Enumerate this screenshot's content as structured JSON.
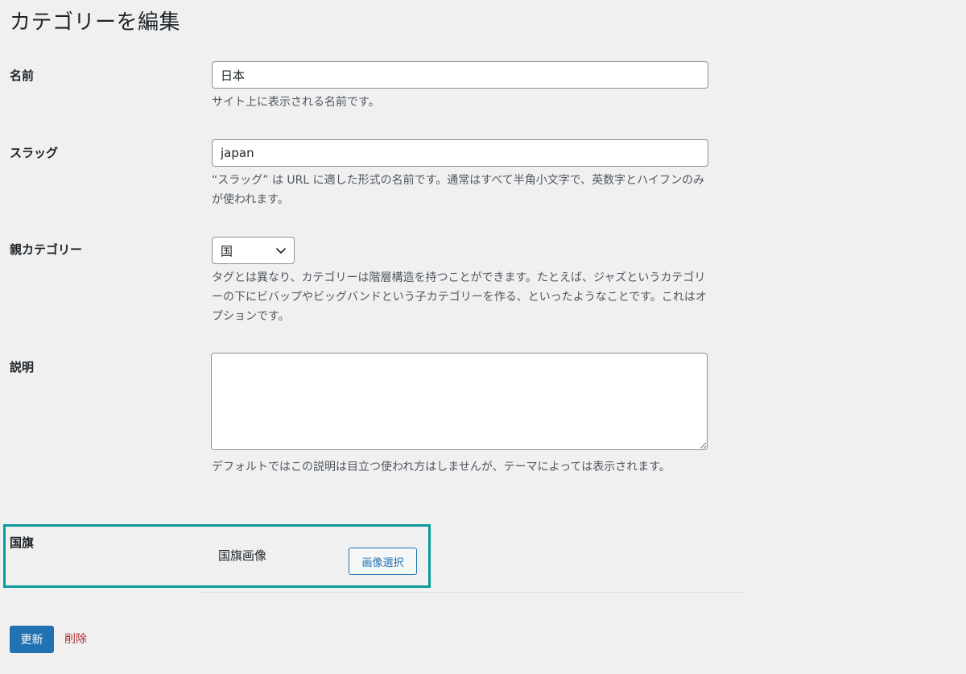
{
  "page": {
    "title": "カテゴリーを編集"
  },
  "fields": {
    "name": {
      "label": "名前",
      "value": "日本",
      "help": "サイト上に表示される名前です。"
    },
    "slug": {
      "label": "スラッグ",
      "value": "japan",
      "help": "“スラッグ” は URL に適した形式の名前です。通常はすべて半角小文字で、英数字とハイフンのみが使われます。"
    },
    "parent": {
      "label": "親カテゴリー",
      "selected": "国",
      "help": "タグとは異なり、カテゴリーは階層構造を持つことができます。たとえば、ジャズというカテゴリーの下にビバップやビッグバンドという子カテゴリーを作る、といったようなことです。これはオプションです。"
    },
    "description": {
      "label": "説明",
      "value": "",
      "help": "デフォルトではこの説明は目立つ使われ方はしませんが、テーマによっては表示されます。"
    },
    "flag": {
      "label": "国旗",
      "field_label": "国旗画像",
      "button_label": "画像選択"
    }
  },
  "actions": {
    "update_label": "更新",
    "delete_label": "削除"
  },
  "colors": {
    "background": "#f0f0f1",
    "accent": "#2271b1",
    "highlight_border": "#0b9a9a",
    "delete": "#b32d2e"
  },
  "icons": {
    "select_arrow": "chevron-down-icon"
  }
}
